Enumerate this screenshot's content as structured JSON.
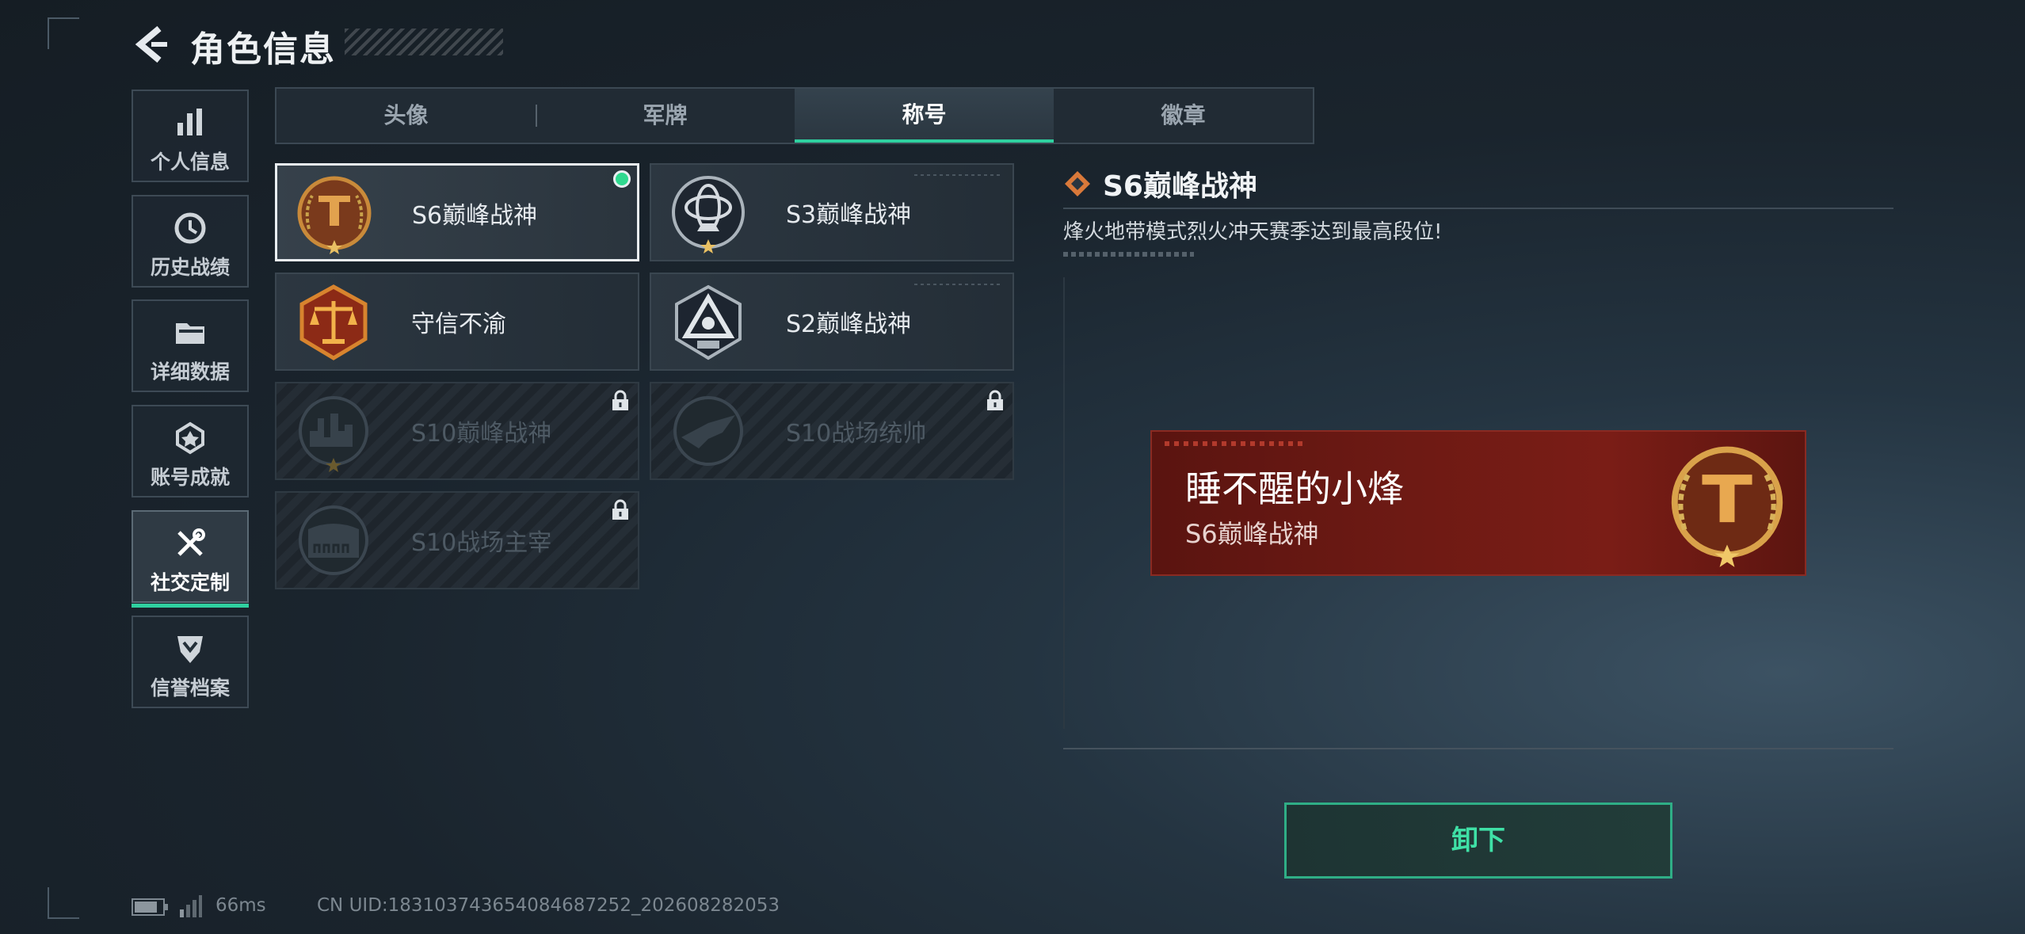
{
  "header": {
    "title": "角色信息"
  },
  "sidebar": {
    "items": [
      {
        "label": "个人信息",
        "icon": "bar-chart-icon"
      },
      {
        "label": "历史战绩",
        "icon": "history-icon"
      },
      {
        "label": "详细数据",
        "icon": "folder-icon"
      },
      {
        "label": "账号成就",
        "icon": "medal-icon"
      },
      {
        "label": "社交定制",
        "icon": "tools-icon",
        "active": true
      },
      {
        "label": "信誉档案",
        "icon": "shield-icon"
      }
    ]
  },
  "tabs": [
    {
      "label": "头像"
    },
    {
      "label": "军牌"
    },
    {
      "label": "称号",
      "active": true
    },
    {
      "label": "徽章"
    }
  ],
  "titles": [
    {
      "label": "S6巅峰战神",
      "emblem": "gold-shield-emblem-icon",
      "state": "equipped"
    },
    {
      "label": "S3巅峰战神",
      "emblem": "silver-globe-emblem-icon",
      "state": "unlocked"
    },
    {
      "label": "守信不渝",
      "emblem": "scales-emblem-icon",
      "state": "unlocked"
    },
    {
      "label": "S2巅峰战神",
      "emblem": "silver-triangle-emblem-icon",
      "state": "unlocked"
    },
    {
      "label": "S10巅峰战神",
      "emblem": "city-emblem-icon",
      "state": "locked"
    },
    {
      "label": "S10战场统帅",
      "emblem": "jet-emblem-icon",
      "state": "locked"
    },
    {
      "label": "S10战场主宰",
      "emblem": "colosseum-emblem-icon",
      "state": "locked"
    }
  ],
  "detail": {
    "title": "S6巅峰战神",
    "description": "烽火地带模式烈火冲天赛季达到最高段位!",
    "preview": {
      "player_name": "睡不醒的小烽",
      "title": "S6巅峰战神"
    },
    "action_label": "卸下"
  },
  "status": {
    "ping": "66ms",
    "uid": "CN UID:18310374365408468725​2_202608282053"
  },
  "colors": {
    "accent": "#2fd0a0",
    "nameplate": "#6e1a14",
    "gold": "#c98a3a"
  }
}
